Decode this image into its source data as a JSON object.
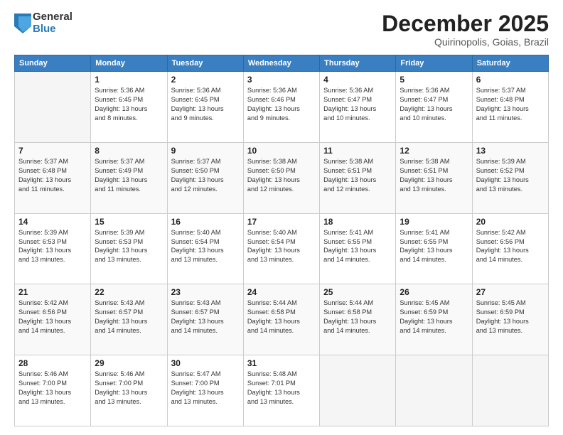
{
  "logo": {
    "general": "General",
    "blue": "Blue"
  },
  "title": "December 2025",
  "location": "Quirinopolis, Goias, Brazil",
  "headers": [
    "Sunday",
    "Monday",
    "Tuesday",
    "Wednesday",
    "Thursday",
    "Friday",
    "Saturday"
  ],
  "weeks": [
    [
      {
        "day": "",
        "info": ""
      },
      {
        "day": "1",
        "info": "Sunrise: 5:36 AM\nSunset: 6:45 PM\nDaylight: 13 hours\nand 8 minutes."
      },
      {
        "day": "2",
        "info": "Sunrise: 5:36 AM\nSunset: 6:45 PM\nDaylight: 13 hours\nand 9 minutes."
      },
      {
        "day": "3",
        "info": "Sunrise: 5:36 AM\nSunset: 6:46 PM\nDaylight: 13 hours\nand 9 minutes."
      },
      {
        "day": "4",
        "info": "Sunrise: 5:36 AM\nSunset: 6:47 PM\nDaylight: 13 hours\nand 10 minutes."
      },
      {
        "day": "5",
        "info": "Sunrise: 5:36 AM\nSunset: 6:47 PM\nDaylight: 13 hours\nand 10 minutes."
      },
      {
        "day": "6",
        "info": "Sunrise: 5:37 AM\nSunset: 6:48 PM\nDaylight: 13 hours\nand 11 minutes."
      }
    ],
    [
      {
        "day": "7",
        "info": "Sunrise: 5:37 AM\nSunset: 6:48 PM\nDaylight: 13 hours\nand 11 minutes."
      },
      {
        "day": "8",
        "info": "Sunrise: 5:37 AM\nSunset: 6:49 PM\nDaylight: 13 hours\nand 11 minutes."
      },
      {
        "day": "9",
        "info": "Sunrise: 5:37 AM\nSunset: 6:50 PM\nDaylight: 13 hours\nand 12 minutes."
      },
      {
        "day": "10",
        "info": "Sunrise: 5:38 AM\nSunset: 6:50 PM\nDaylight: 13 hours\nand 12 minutes."
      },
      {
        "day": "11",
        "info": "Sunrise: 5:38 AM\nSunset: 6:51 PM\nDaylight: 13 hours\nand 12 minutes."
      },
      {
        "day": "12",
        "info": "Sunrise: 5:38 AM\nSunset: 6:51 PM\nDaylight: 13 hours\nand 13 minutes."
      },
      {
        "day": "13",
        "info": "Sunrise: 5:39 AM\nSunset: 6:52 PM\nDaylight: 13 hours\nand 13 minutes."
      }
    ],
    [
      {
        "day": "14",
        "info": "Sunrise: 5:39 AM\nSunset: 6:53 PM\nDaylight: 13 hours\nand 13 minutes."
      },
      {
        "day": "15",
        "info": "Sunrise: 5:39 AM\nSunset: 6:53 PM\nDaylight: 13 hours\nand 13 minutes."
      },
      {
        "day": "16",
        "info": "Sunrise: 5:40 AM\nSunset: 6:54 PM\nDaylight: 13 hours\nand 13 minutes."
      },
      {
        "day": "17",
        "info": "Sunrise: 5:40 AM\nSunset: 6:54 PM\nDaylight: 13 hours\nand 13 minutes."
      },
      {
        "day": "18",
        "info": "Sunrise: 5:41 AM\nSunset: 6:55 PM\nDaylight: 13 hours\nand 14 minutes."
      },
      {
        "day": "19",
        "info": "Sunrise: 5:41 AM\nSunset: 6:55 PM\nDaylight: 13 hours\nand 14 minutes."
      },
      {
        "day": "20",
        "info": "Sunrise: 5:42 AM\nSunset: 6:56 PM\nDaylight: 13 hours\nand 14 minutes."
      }
    ],
    [
      {
        "day": "21",
        "info": "Sunrise: 5:42 AM\nSunset: 6:56 PM\nDaylight: 13 hours\nand 14 minutes."
      },
      {
        "day": "22",
        "info": "Sunrise: 5:43 AM\nSunset: 6:57 PM\nDaylight: 13 hours\nand 14 minutes."
      },
      {
        "day": "23",
        "info": "Sunrise: 5:43 AM\nSunset: 6:57 PM\nDaylight: 13 hours\nand 14 minutes."
      },
      {
        "day": "24",
        "info": "Sunrise: 5:44 AM\nSunset: 6:58 PM\nDaylight: 13 hours\nand 14 minutes."
      },
      {
        "day": "25",
        "info": "Sunrise: 5:44 AM\nSunset: 6:58 PM\nDaylight: 13 hours\nand 14 minutes."
      },
      {
        "day": "26",
        "info": "Sunrise: 5:45 AM\nSunset: 6:59 PM\nDaylight: 13 hours\nand 14 minutes."
      },
      {
        "day": "27",
        "info": "Sunrise: 5:45 AM\nSunset: 6:59 PM\nDaylight: 13 hours\nand 13 minutes."
      }
    ],
    [
      {
        "day": "28",
        "info": "Sunrise: 5:46 AM\nSunset: 7:00 PM\nDaylight: 13 hours\nand 13 minutes."
      },
      {
        "day": "29",
        "info": "Sunrise: 5:46 AM\nSunset: 7:00 PM\nDaylight: 13 hours\nand 13 minutes."
      },
      {
        "day": "30",
        "info": "Sunrise: 5:47 AM\nSunset: 7:00 PM\nDaylight: 13 hours\nand 13 minutes."
      },
      {
        "day": "31",
        "info": "Sunrise: 5:48 AM\nSunset: 7:01 PM\nDaylight: 13 hours\nand 13 minutes."
      },
      {
        "day": "",
        "info": ""
      },
      {
        "day": "",
        "info": ""
      },
      {
        "day": "",
        "info": ""
      }
    ]
  ]
}
